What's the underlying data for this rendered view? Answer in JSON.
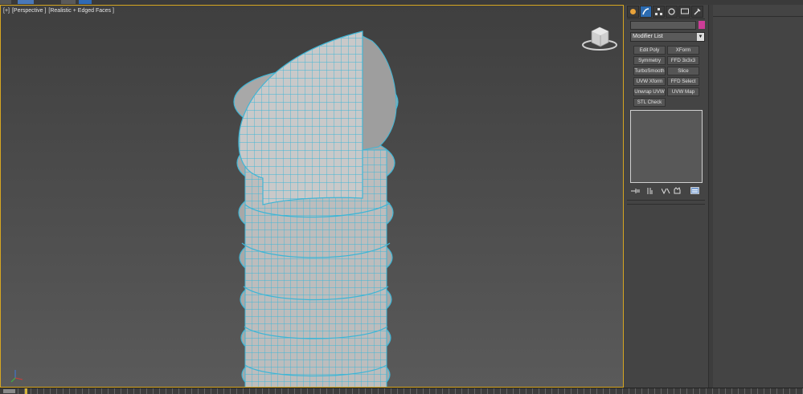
{
  "window": {
    "accent_color": "#d6a621"
  },
  "viewport": {
    "label_parts": [
      "[+]",
      "[Perspective ]",
      "[Realistic + Edged Faces ]"
    ],
    "object": "tower-mesh",
    "mesh_fill": "#c8c8c8",
    "edge_color": "#3fb6d6"
  },
  "command_panel": {
    "tabs": [
      "create-icon",
      "modify-icon",
      "hierarchy-icon",
      "motion-icon",
      "display-icon",
      "utilities-icon"
    ],
    "active_tab": "modify-icon",
    "object_name": "",
    "object_color": "#cc3d97",
    "modifier_list": {
      "selected": "Modifier List"
    },
    "modifier_buttons": [
      "Edit Poly",
      "XForm",
      "Symmetry",
      "FFD 3x3x3",
      "TurboSmooth",
      "Slice",
      "UVW Xform",
      "FFD Select",
      "Unwrap UVW",
      "UVW Map",
      "STL Check"
    ],
    "stack_tools": [
      "pin-stack-icon",
      "show-end-result-icon",
      "make-unique-icon",
      "remove-modifier-icon",
      "configure-sets-icon"
    ]
  },
  "timeline": {
    "current_frame": 0
  }
}
